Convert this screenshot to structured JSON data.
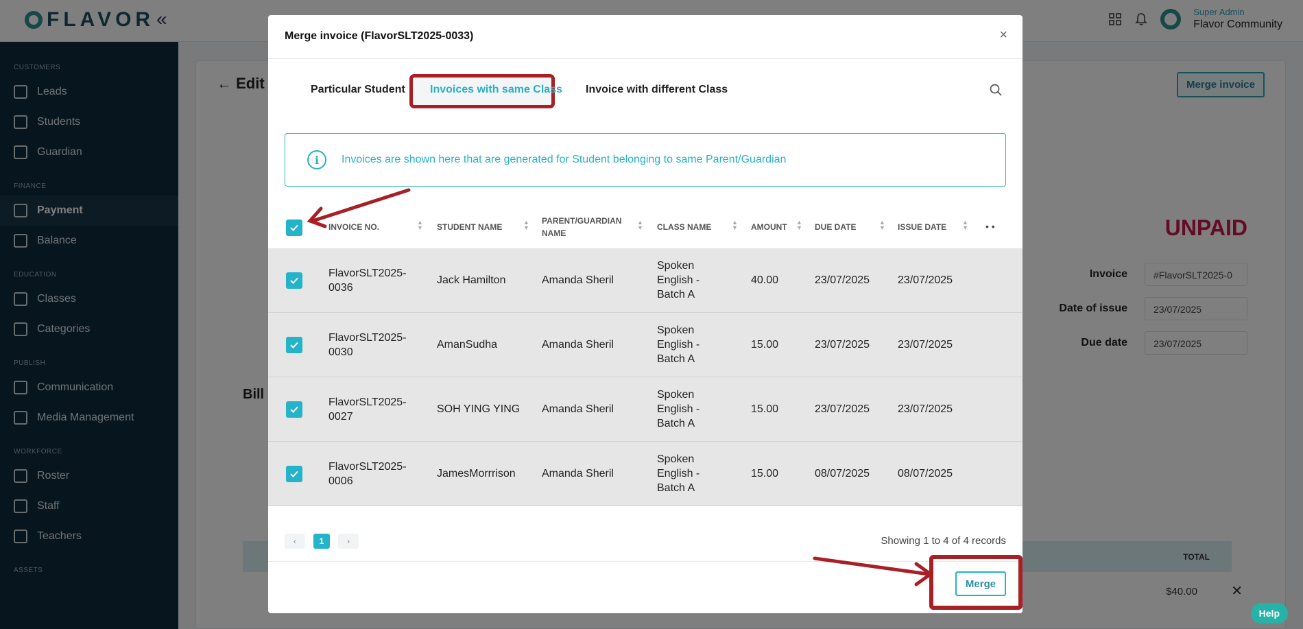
{
  "app": {
    "logo_text": "FLAVOR",
    "collapse_icon": "«",
    "user": {
      "role": "Super Admin",
      "name": "Flavor Community"
    }
  },
  "sidebar": {
    "sections": [
      {
        "title": "CUSTOMERS",
        "items": [
          {
            "label": "Leads"
          },
          {
            "label": "Students"
          },
          {
            "label": "Guardian"
          }
        ]
      },
      {
        "title": "FINANCE",
        "items": [
          {
            "label": "Payment",
            "active": true
          },
          {
            "label": "Balance"
          }
        ]
      },
      {
        "title": "EDUCATION",
        "items": [
          {
            "label": "Classes"
          },
          {
            "label": "Categories"
          }
        ]
      },
      {
        "title": "PUBLISH",
        "items": [
          {
            "label": "Communication"
          },
          {
            "label": "Media Management"
          }
        ]
      },
      {
        "title": "WORKFORCE",
        "items": [
          {
            "label": "Roster"
          },
          {
            "label": "Staff"
          },
          {
            "label": "Teachers"
          }
        ]
      },
      {
        "title": "ASSETS",
        "items": []
      }
    ]
  },
  "background": {
    "page_title": "Edit I",
    "merge_button": "Merge invoice",
    "status": "UNPAID",
    "invoice_label": "Invoice",
    "invoice_value": "#FlavorSLT2025-0",
    "date_issue_label": "Date of issue",
    "date_issue_value": "23/07/2025",
    "due_date_label": "Due date",
    "due_date_value": "23/07/2025",
    "bill_to": "Bill t",
    "table_total_header": "TOTAL",
    "table_total_value": "$40.00",
    "help_button": "Help"
  },
  "modal": {
    "title": "Merge invoice (FlavorSLT2025-0033)",
    "close_icon": "×",
    "tabs": [
      {
        "label": "Particular Student"
      },
      {
        "label": "Invoices with same Class",
        "active": true
      },
      {
        "label": "Invoice with different Class"
      }
    ],
    "info_text": "Invoices are shown here that are generated for Student belonging to same Parent/Guardian",
    "columns": {
      "invoice_no": "INVOICE NO.",
      "student_name": "STUDENT NAME",
      "parent_1": "PARENT/GUARDIAN",
      "parent_2": "NAME",
      "class_name": "CLASS NAME",
      "amount": "AMOUNT",
      "due_date": "DUE DATE",
      "issue_date": "ISSUE DATE"
    },
    "rows": [
      {
        "invoice_1": "FlavorSLT2025-",
        "invoice_2": "0036",
        "student": "Jack Hamilton",
        "parent": "Amanda Sheril",
        "class_1": "Spoken",
        "class_2": "English -",
        "class_3": "Batch A",
        "amount": "40.00",
        "due": "23/07/2025",
        "issue": "23/07/2025",
        "checked": true
      },
      {
        "invoice_1": "FlavorSLT2025-",
        "invoice_2": "0030",
        "student": "AmanSudha",
        "parent": "Amanda Sheril",
        "class_1": "Spoken",
        "class_2": "English -",
        "class_3": "Batch A",
        "amount": "15.00",
        "due": "23/07/2025",
        "issue": "23/07/2025",
        "checked": true
      },
      {
        "invoice_1": "FlavorSLT2025-",
        "invoice_2": "0027",
        "student": "SOH YING YING",
        "parent": "Amanda Sheril",
        "class_1": "Spoken",
        "class_2": "English -",
        "class_3": "Batch A",
        "amount": "15.00",
        "due": "23/07/2025",
        "issue": "23/07/2025",
        "checked": true
      },
      {
        "invoice_1": "FlavorSLT2025-",
        "invoice_2": "0006",
        "student": "JamesMorrrison",
        "parent": "Amanda Sheril",
        "class_1": "Spoken",
        "class_2": "English -",
        "class_3": "Batch A",
        "amount": "15.00",
        "due": "08/07/2025",
        "issue": "08/07/2025",
        "checked": true
      }
    ],
    "pagination": {
      "prev": "‹",
      "current": "1",
      "next": "›"
    },
    "showing_text": "Showing 1 to 4 of 4 records",
    "merge_button": "Merge"
  },
  "colors": {
    "accent": "#25b3c9",
    "annotation_red": "#a81f26",
    "sidebar_bg": "#0f2a3d",
    "unpaid": "#c8174d"
  }
}
